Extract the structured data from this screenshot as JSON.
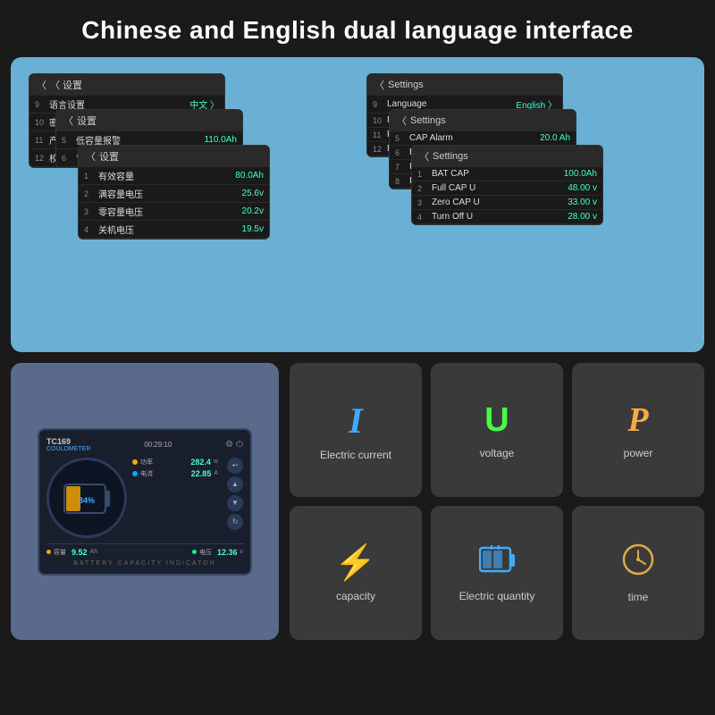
{
  "header": {
    "title": "Chinese and English dual language interface"
  },
  "cn_screens": {
    "screen1": {
      "header": "〈 设置",
      "rows": [
        {
          "num": "9",
          "label": "语言设置",
          "value": "中文 〉"
        },
        {
          "num": "10",
          "label": "密码设置",
          "value": ""
        },
        {
          "num": "11",
          "label": "产品信息",
          "value": ""
        },
        {
          "num": "12",
          "label": "校复出",
          "value": ""
        }
      ]
    },
    "screen2": {
      "header": "〈 设置",
      "rows": [
        {
          "num": "5",
          "label": "低容量报警",
          "value": "110.0Ah"
        },
        {
          "num": "6",
          "label": "背光亮",
          "value": ""
        }
      ]
    },
    "screen3": {
      "header": "〈 设置",
      "rows": [
        {
          "num": "1",
          "label": "有效容量",
          "value": "80.0Ah"
        },
        {
          "num": "2",
          "label": "满容量电压",
          "value": "25.6v"
        },
        {
          "num": "3",
          "label": "零容量电压",
          "value": "20.2v"
        },
        {
          "num": "4",
          "label": "关机电压",
          "value": "19.5v"
        }
      ]
    }
  },
  "en_screens": {
    "screen1": {
      "header": "〈 Settings",
      "rows": [
        {
          "num": "9",
          "label": "Language",
          "value": "English 〉"
        },
        {
          "num": "10",
          "label": "Password Settings",
          "value": ""
        },
        {
          "num": "11",
          "label": "Product In",
          "value": ""
        },
        {
          "num": "12",
          "label": "Factory Re",
          "value": ""
        }
      ]
    },
    "screen2": {
      "header": "〈 Settings",
      "rows": [
        {
          "num": "5",
          "label": "CAP Alarm",
          "value": "20.0 Ah"
        },
        {
          "num": "6",
          "label": "Backlight",
          "value": ""
        }
      ]
    },
    "screen3": {
      "header": "〈 Settings",
      "rows": [
        {
          "num": "1",
          "label": "BAT CAP",
          "value": "100.0Ah"
        },
        {
          "num": "2",
          "label": "Full CAP U",
          "value": "48.00 v"
        },
        {
          "num": "3",
          "label": "Zero CAP U",
          "value": "33.00 v"
        },
        {
          "num": "4",
          "label": "Turn Off U",
          "value": "28.00 v"
        }
      ]
    },
    "idle_rows": [
      {
        "num": "7",
        "label": "IDLE Back",
        "value": ""
      },
      {
        "num": "8",
        "label": "IDLE Curre",
        "value": ""
      }
    ]
  },
  "device": {
    "brand": "TC169",
    "model": "COULOMETER",
    "time": "00:29:10",
    "percent": "34%",
    "stats": [
      {
        "color": "#ffaa00",
        "label": "功率",
        "value": "282.4",
        "unit": "w"
      },
      {
        "color": "#00aaff",
        "label": "电流",
        "value": "22.85",
        "unit": "A"
      }
    ],
    "bottom": [
      {
        "color": "#ffaa00",
        "label": "容量",
        "value": "9.52",
        "unit": "Ah"
      },
      {
        "color": "#00ff88",
        "label": "电压",
        "value": "12.36",
        "unit": "v"
      }
    ],
    "footer": "BATTERY   CAPACITY   INDICATOR"
  },
  "features": [
    {
      "id": "current",
      "icon": "I",
      "label": "Electric current",
      "type": "I"
    },
    {
      "id": "voltage",
      "icon": "U",
      "label": "voltage",
      "type": "U"
    },
    {
      "id": "power",
      "icon": "P",
      "label": "power",
      "type": "P"
    },
    {
      "id": "capacity",
      "icon": "⚡",
      "label": "capacity",
      "type": "bolt"
    },
    {
      "id": "electric-quantity",
      "icon": "🔋",
      "label": "Electric quantity",
      "type": "battery"
    },
    {
      "id": "time",
      "icon": "🕐",
      "label": "time",
      "type": "clock"
    }
  ]
}
